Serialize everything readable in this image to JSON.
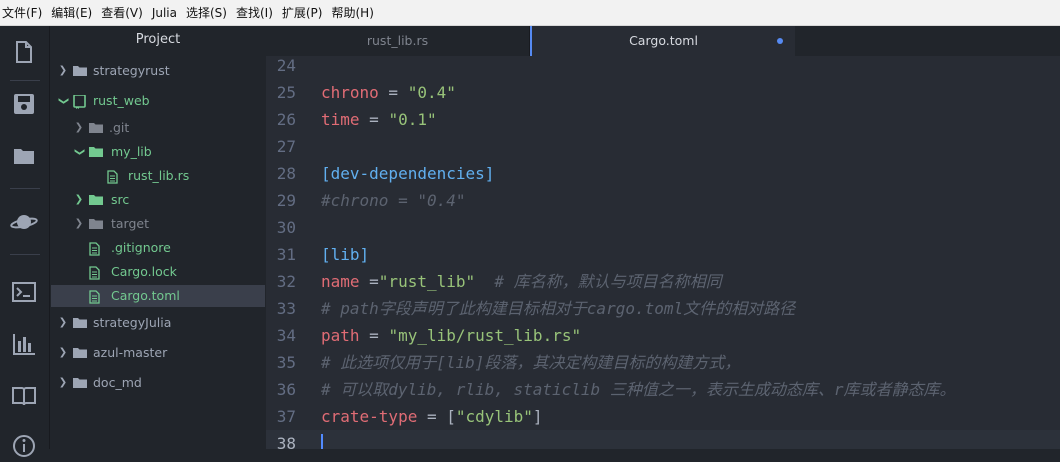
{
  "menu": {
    "items": [
      "文件(F)",
      "编辑(E)",
      "查看(V)",
      "Julia",
      "选择(S)",
      "查找(I)",
      "扩展(P)",
      "帮助(H)"
    ]
  },
  "activity_bar": {
    "icons": [
      "file-icon",
      "save-icon",
      "folder-icon",
      "julia-planet-icon",
      "terminal-icon",
      "chart-icon",
      "book-icon",
      "info-icon"
    ]
  },
  "tree": {
    "header": "Project",
    "nodes": {
      "strategyrust": "strategyrust",
      "rust_web": "rust_web",
      "git": ".git",
      "my_lib": "my_lib",
      "rust_lib": "rust_lib.rs",
      "src": "src",
      "target": "target",
      "gitignore": ".gitignore",
      "cargo_lock": "Cargo.lock",
      "cargo_toml": "Cargo.toml",
      "strategyJulia": "strategyJulia",
      "azul_master": "azul-master",
      "doc_md": "doc_md"
    }
  },
  "tabs": [
    {
      "label": "rust_lib.rs",
      "active": false
    },
    {
      "label": "Cargo.toml",
      "active": true,
      "modified": true
    }
  ],
  "editor": {
    "lines": [
      {
        "num": "24",
        "parts": []
      },
      {
        "num": "25",
        "parts": [
          [
            "k",
            "chrono"
          ],
          [
            "p",
            " = "
          ],
          [
            "s",
            "\"0.4\""
          ]
        ]
      },
      {
        "num": "26",
        "parts": [
          [
            "k",
            "time"
          ],
          [
            "p",
            " = "
          ],
          [
            "s",
            "\"0.1\""
          ]
        ]
      },
      {
        "num": "27",
        "parts": []
      },
      {
        "num": "28",
        "parts": [
          [
            "sec",
            "[dev-dependencies]"
          ]
        ]
      },
      {
        "num": "29",
        "parts": [
          [
            "c",
            "#chrono = \"0.4\""
          ]
        ]
      },
      {
        "num": "30",
        "parts": []
      },
      {
        "num": "31",
        "parts": [
          [
            "sec",
            "[lib]"
          ]
        ]
      },
      {
        "num": "32",
        "parts": [
          [
            "k",
            "name"
          ],
          [
            "p",
            " ="
          ],
          [
            "s",
            "\"rust_lib\""
          ],
          [
            "c",
            "  # 库名称，默认与项目名称相同"
          ]
        ]
      },
      {
        "num": "33",
        "parts": [
          [
            "c",
            "# path字段声明了此构建目标相对于cargo.toml文件的相对路径"
          ]
        ]
      },
      {
        "num": "34",
        "parts": [
          [
            "k",
            "path"
          ],
          [
            "p",
            " = "
          ],
          [
            "s",
            "\"my_lib/rust_lib.rs\""
          ]
        ]
      },
      {
        "num": "35",
        "parts": [
          [
            "c",
            "# 此选项仅用于[lib]段落，其决定构建目标的构建方式，"
          ]
        ]
      },
      {
        "num": "36",
        "parts": [
          [
            "c",
            "# 可以取dylib, rlib, staticlib 三种值之一，表示生成动态库、r库或者静态库。"
          ]
        ]
      },
      {
        "num": "37",
        "parts": [
          [
            "k",
            "crate-type"
          ],
          [
            "p",
            " = ["
          ],
          [
            "s",
            "\"cdylib\""
          ],
          [
            "p",
            "]"
          ]
        ]
      },
      {
        "num": "38",
        "parts": [],
        "current": true
      }
    ]
  },
  "colors": {
    "accent": "#568af2",
    "git_added": "#73c990",
    "key": "#e06c75",
    "string": "#98c379",
    "section": "#61afef",
    "comment": "#5c6370"
  }
}
